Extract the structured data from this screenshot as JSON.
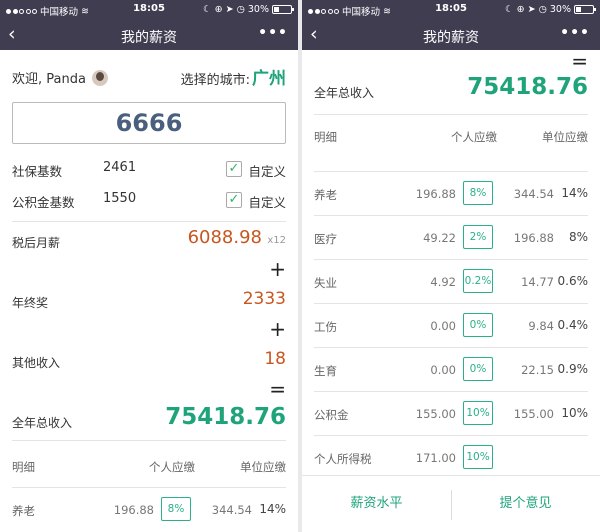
{
  "status": {
    "carrier": "中国移动",
    "time": "18:05",
    "battery": "30%",
    "battery_level": 0.3
  },
  "nav": {
    "back": "‹",
    "title": "我的薪资",
    "more": "•••"
  },
  "welcome": {
    "text": "欢迎, Panda",
    "city_label": "选择的城市:",
    "city": "广州"
  },
  "salary_input": {
    "value": "6666"
  },
  "social_base": {
    "label": "社保基数",
    "value": "2461",
    "custom_label": "自定义",
    "checked": true
  },
  "fund_base": {
    "label": "公积金基数",
    "value": "1550",
    "custom_label": "自定义",
    "checked": true
  },
  "after_tax": {
    "label": "税后月薪",
    "value": "6088.98",
    "mult": "x12"
  },
  "plus": "+",
  "equals": "=",
  "bonus": {
    "label": "年终奖",
    "value": "2333"
  },
  "other": {
    "label": "其他收入",
    "value": "18"
  },
  "total": {
    "label": "全年总收入",
    "value": "75418.76"
  },
  "table": {
    "headers": [
      "明细",
      "个人应缴",
      "单位应缴"
    ],
    "rows": [
      {
        "name": "养老",
        "personal": "196.88",
        "rate": "8%",
        "company": "344.54",
        "company_rate": "14%"
      },
      {
        "name": "医疗",
        "personal": "49.22",
        "rate": "2%",
        "company": "196.88",
        "company_rate": "8%"
      },
      {
        "name": "失业",
        "personal": "4.92",
        "rate": "0.2%",
        "company": "14.77",
        "company_rate": "0.6%"
      },
      {
        "name": "工伤",
        "personal": "0.00",
        "rate": "0%",
        "company": "9.84",
        "company_rate": "0.4%"
      },
      {
        "name": "生育",
        "personal": "0.00",
        "rate": "0%",
        "company": "22.15",
        "company_rate": "0.9%"
      },
      {
        "name": "公积金",
        "personal": "155.00",
        "rate": "10%",
        "company": "155.00",
        "company_rate": "10%"
      },
      {
        "name": "个人所得税",
        "personal": "171.00",
        "rate": "10%",
        "company": "",
        "company_rate": ""
      }
    ]
  },
  "bottom": {
    "salary_level": "薪资水平",
    "feedback": "提个意见"
  },
  "colors": {
    "nav": "#403d51",
    "green": "#1fa37a",
    "orange": "#c8561f"
  }
}
